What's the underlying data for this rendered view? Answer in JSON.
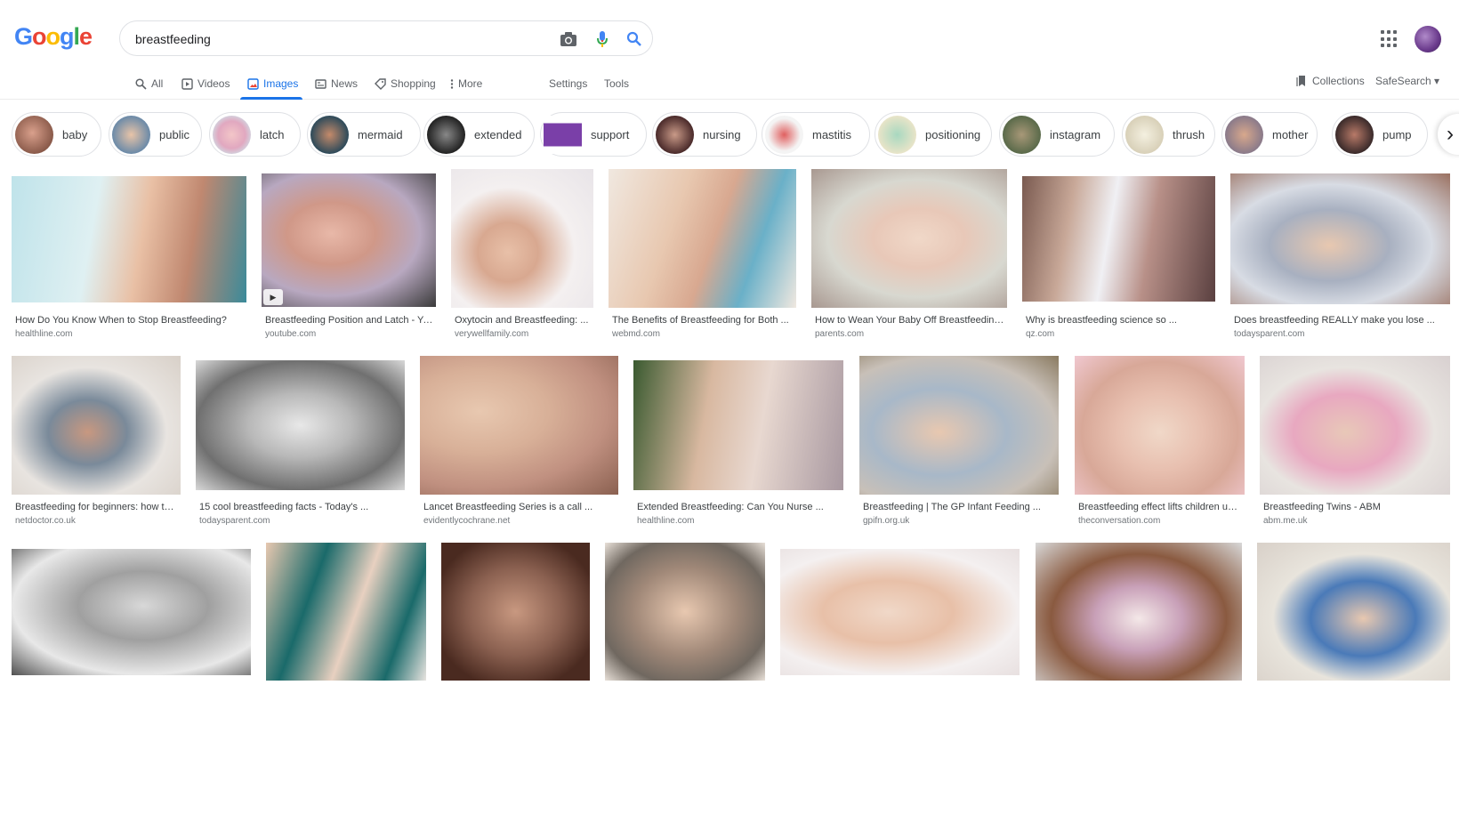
{
  "search": {
    "query": "breastfeeding"
  },
  "logo": {
    "letters": [
      "G",
      "o",
      "o",
      "g",
      "l",
      "e"
    ],
    "colors": [
      "#4285f4",
      "#ea4335",
      "#fbbc05",
      "#4285f4",
      "#34a853",
      "#ea4335"
    ]
  },
  "nav": {
    "tabs": [
      {
        "label": "All",
        "icon": "search-icon"
      },
      {
        "label": "Videos",
        "icon": "play-icon"
      },
      {
        "label": "Images",
        "icon": "image-icon"
      },
      {
        "label": "News",
        "icon": "news-icon"
      },
      {
        "label": "Shopping",
        "icon": "tag-icon"
      },
      {
        "label": "More",
        "icon": "dots-vertical-icon"
      }
    ],
    "settings": "Settings",
    "tools": "Tools",
    "collections": "Collections",
    "safesearch": "SafeSearch ▾",
    "active_color": "#1a73e8"
  },
  "chips": [
    "baby",
    "public",
    "latch",
    "mermaid",
    "extended",
    "support",
    "nursing",
    "mastitis",
    "positioning",
    "instagram",
    "thrush",
    "mother",
    "pump"
  ],
  "results": [
    {
      "title": "How Do You Know When to Stop Breastfeeding?",
      "source": "healthline.com"
    },
    {
      "title": "Breastfeeding Position and Latch - YouTube",
      "source": "youtube.com"
    },
    {
      "title": "Oxytocin and Breastfeeding: ...",
      "source": "verywellfamily.com"
    },
    {
      "title": "The Benefits of Breastfeeding for Both ...",
      "source": "webmd.com"
    },
    {
      "title": "How to Wean Your Baby Off Breastfeeding ...",
      "source": "parents.com"
    },
    {
      "title": "Why is breastfeeding science so ...",
      "source": "qz.com"
    },
    {
      "title": "Does breastfeeding REALLY make you lose ...",
      "source": "todaysparent.com"
    },
    {
      "title": "Breastfeeding for beginners: how to ...",
      "source": "netdoctor.co.uk"
    },
    {
      "title": "15 cool breastfeeding facts - Today's ...",
      "source": "todaysparent.com"
    },
    {
      "title": "Lancet Breastfeeding Series is a call ...",
      "source": "evidentlycochrane.net"
    },
    {
      "title": "Extended Breastfeeding: Can You Nurse ...",
      "source": "healthline.com"
    },
    {
      "title": "Breastfeeding | The GP Infant Feeding ...",
      "source": "gpifn.org.uk"
    },
    {
      "title": "Breastfeeding effect lifts children up ...",
      "source": "theconversation.com"
    },
    {
      "title": "Breastfeeding Twins - ABM",
      "source": "abm.me.uk"
    }
  ]
}
